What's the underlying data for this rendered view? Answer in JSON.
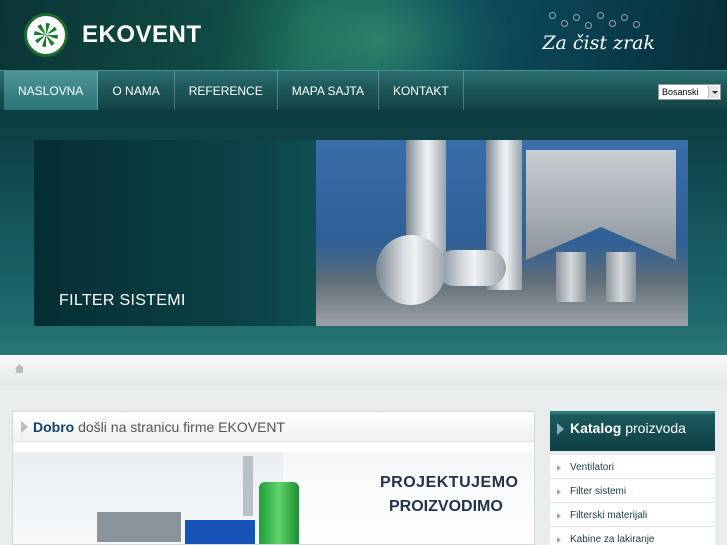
{
  "header": {
    "brand": "EKOVENT",
    "tagline": "Za čist zrak"
  },
  "nav": {
    "items": [
      "NASLOVNA",
      "O NAMA",
      "REFERENCE",
      "MAPA SAJTA",
      "KONTAKT"
    ],
    "active_index": 0,
    "language": "Bosanski"
  },
  "banner": {
    "caption": "FILTER SISTEMI"
  },
  "content": {
    "title_bold": "Dobro",
    "title_rest": " došli na stranicu firme EKOVENT",
    "hero_line1": "PROJEKTUJEMO",
    "hero_line2": "PROIZVODIMO"
  },
  "catalog": {
    "title_bold": "Katalog",
    "title_rest": " proizvoda",
    "items": [
      "Ventilatori",
      "Filter sistemi",
      "Filterski materijali",
      "Kabine za lakiranje"
    ]
  },
  "colors": {
    "header_dark": "#0c3436",
    "nav": "#1b5558",
    "title_blue": "#133f6e"
  }
}
